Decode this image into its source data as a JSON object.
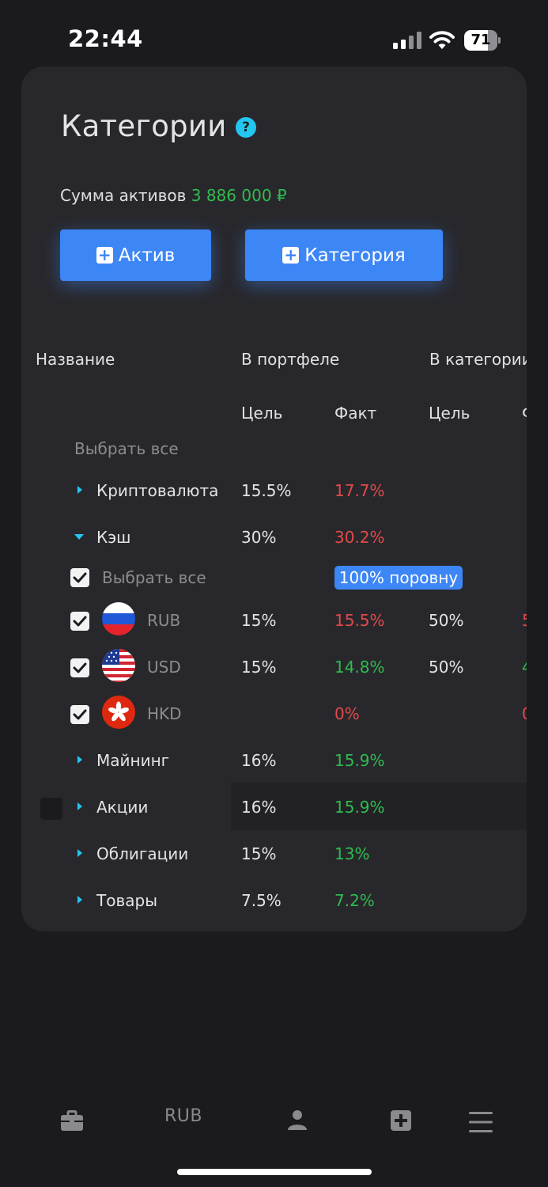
{
  "status_bar": {
    "time": "22:44",
    "battery": "71",
    "battery_level": 0.71
  },
  "header": {
    "title": "Категории"
  },
  "summary": {
    "label": "Сумма активов",
    "value": "3 886 000 ₽"
  },
  "actions": {
    "add_asset": "Актив",
    "add_category": "Категория"
  },
  "table": {
    "headers": {
      "name": "Название",
      "in_portfolio": "В портфеле",
      "in_category": "В категории"
    },
    "subheaders": {
      "goal": "Цель",
      "fact": "Факт",
      "goal2": "Цель",
      "fact2_partial": "Ф"
    },
    "select_all": "Выбрать все",
    "rows": [
      {
        "name": "Криптовалюта",
        "goal": "15.5%",
        "fact": "17.7%"
      },
      {
        "name": "Кэш",
        "goal": "30%",
        "fact": "30.2%",
        "select_all": "Выбрать все",
        "split_label": "100% поровну",
        "children": [
          {
            "name": "RUB",
            "goal": "15%",
            "fact": "15.5%",
            "cat_goal": "50%",
            "cat_fact_partial": "5"
          },
          {
            "name": "USD",
            "goal": "15%",
            "fact": "14.8%",
            "cat_goal": "50%",
            "cat_fact_partial": "4"
          },
          {
            "name": "HKD",
            "goal": "",
            "fact": "0%",
            "cat_goal": "",
            "cat_fact_partial": "0"
          }
        ]
      },
      {
        "name": "Майнинг",
        "goal": "16%",
        "fact": "15.9%"
      },
      {
        "name": "Акции",
        "goal": "16%",
        "fact": "15.9%"
      },
      {
        "name": "Облигации",
        "goal": "15%",
        "fact": "13%"
      },
      {
        "name": "Товары",
        "goal": "7.5%",
        "fact": "7.2%"
      }
    ]
  },
  "tabbar": {
    "currency": "RUB"
  },
  "colors": {
    "accent": "#3d86f5",
    "positive": "#2fbb4f",
    "negative": "#e24a4a",
    "info": "#23c6ef"
  }
}
